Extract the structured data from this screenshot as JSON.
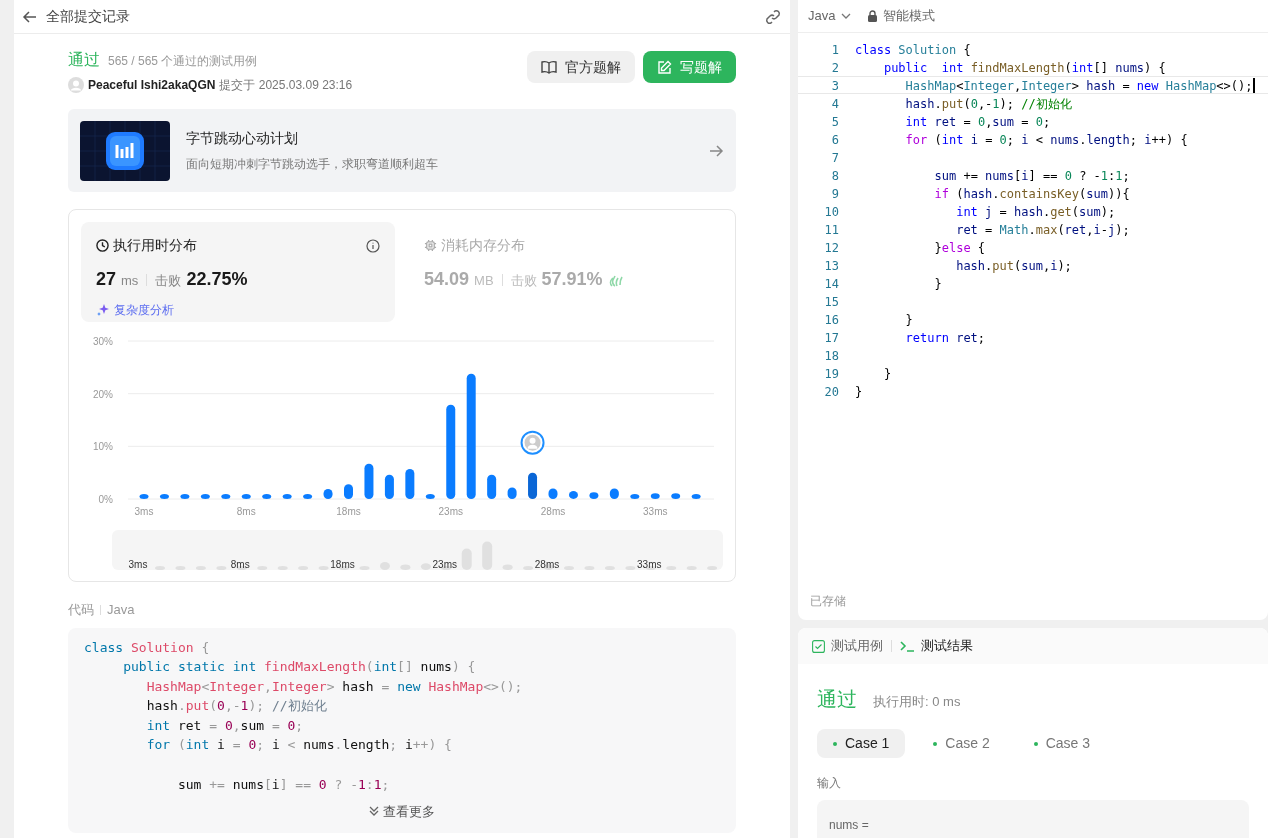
{
  "header": {
    "title": "全部提交记录"
  },
  "submission": {
    "status": "通过",
    "tests": "565 / 565 个通过的测试用例",
    "user": "Peaceful Ishi2akaQGN",
    "submitted": "提交于 2025.03.09 23:16"
  },
  "buttons": [
    {
      "label": "官方题解",
      "kind": "secondary"
    },
    {
      "label": "写题解",
      "kind": "primary"
    }
  ],
  "banner": {
    "kind": "picture",
    "title": "字节跳动心动计划",
    "subtitle": "面向短期冲刺字节跳动选手，求职弯道顺利超车"
  },
  "stats_tabs": [
    {
      "kind": "time",
      "title": "执行用时分布",
      "value": "27",
      "unit": "ms",
      "beats_label": "击败",
      "beats": "22.75%",
      "link": "复杂度分析",
      "selected": true
    },
    {
      "kind": "memory",
      "title": "消耗内存分布",
      "value": "54.09",
      "unit": "MB",
      "beats_label": "击败",
      "beats": "57.91%",
      "selected": false
    }
  ],
  "chart_data": {
    "type": "bar",
    "categories": [
      "3ms",
      null,
      null,
      null,
      null,
      "8ms",
      null,
      null,
      null,
      null,
      "18ms",
      null,
      null,
      null,
      null,
      "23ms",
      null,
      null,
      null,
      null,
      "28ms",
      null,
      null,
      null,
      null,
      "33ms",
      null,
      null
    ],
    "values": [
      0.9,
      0.9,
      0.9,
      0.9,
      0.9,
      0.9,
      0.9,
      0.9,
      0.9,
      1.9,
      2.8,
      6.7,
      4.6,
      5.7,
      0.9,
      17.9,
      23.8,
      4.6,
      2.2,
      5.0,
      2.0,
      1.5,
      1.3,
      2.0,
      0.9,
      1.1,
      1.1,
      0.9
    ],
    "ylim": [
      0,
      30
    ],
    "yticks": [
      {
        "value": 0,
        "label": "0%"
      },
      {
        "value": 10,
        "label": "10%"
      },
      {
        "value": 20,
        "label": "20%"
      },
      {
        "value": 30,
        "label": "30%"
      }
    ]
  },
  "navigator": {
    "labels": [
      "3ms",
      "8ms",
      "18ms",
      "23ms",
      "28ms",
      "33ms"
    ]
  },
  "code_section": {
    "label": "代码",
    "language": "Java",
    "more": "查看更多",
    "lines": [
      {
        "kind": "code",
        "text": "class Solution {"
      },
      {
        "kind": "code",
        "text": "     public static int findMaxLength(int[] nums) {"
      },
      {
        "kind": "code",
        "text": "        HashMap<Integer,Integer> hash = new HashMap<>();"
      },
      {
        "kind": "code",
        "text": "        hash.put(0,-1); //初始化"
      },
      {
        "kind": "code",
        "text": "        int ret = 0,sum = 0;"
      },
      {
        "kind": "code",
        "text": "        for (int i = 0; i < nums.length; i++) {"
      },
      {
        "kind": "blank"
      },
      {
        "kind": "code",
        "text": "            sum += nums[i] == 0 ? -1:1;"
      }
    ]
  },
  "editor": {
    "language": "Java",
    "mode": "智能模式",
    "saved": "已存储",
    "lines": [
      {
        "number": "1",
        "current": false,
        "text": "class Solution {"
      },
      {
        "number": "2",
        "current": false,
        "text": "    public  int findMaxLength(int[] nums) {"
      },
      {
        "number": "3",
        "current": true,
        "text": "       HashMap<Integer,Integer> hash = new HashMap<>();"
      },
      {
        "number": "4",
        "current": false,
        "text": "       hash.put(0,-1); //初始化"
      },
      {
        "number": "5",
        "current": false,
        "text": "       int ret = 0,sum = 0;"
      },
      {
        "number": "6",
        "current": false,
        "text": "       for (int i = 0; i < nums.length; i++) {"
      },
      {
        "number": "7",
        "current": false
      },
      {
        "number": "8",
        "current": false,
        "text": "           sum += nums[i] == 0 ? -1:1;"
      },
      {
        "number": "9",
        "current": false,
        "text": "           if (hash.containsKey(sum)){"
      },
      {
        "number": "10",
        "current": false,
        "text": "              int j = hash.get(sum);"
      },
      {
        "number": "11",
        "current": false,
        "text": "              ret = Math.max(ret,i-j);"
      },
      {
        "number": "12",
        "current": false,
        "text": "           }else {"
      },
      {
        "number": "13",
        "current": false,
        "text": "              hash.put(sum,i);"
      },
      {
        "number": "14",
        "current": false,
        "text": "           }"
      },
      {
        "number": "15",
        "current": false
      },
      {
        "number": "16",
        "current": false,
        "text": "       }"
      },
      {
        "number": "17",
        "current": false,
        "text": "       return ret;"
      },
      {
        "number": "18",
        "current": false
      },
      {
        "number": "19",
        "current": false,
        "text": "    }"
      },
      {
        "number": "20",
        "current": false,
        "text": "}"
      }
    ]
  },
  "test_tabs": [
    {
      "label": "测试用例",
      "kind": "cases",
      "selected": false
    },
    {
      "label": "测试结果",
      "kind": "result",
      "selected": true
    }
  ],
  "result": {
    "status": "通过",
    "runtime": "执行用时: 0 ms"
  },
  "cases": [
    {
      "label": "Case 1",
      "selected": true
    },
    {
      "label": "Case 2",
      "selected": false
    },
    {
      "label": "Case 3",
      "selected": false
    }
  ],
  "input": {
    "label": "输入",
    "name": "nums ="
  }
}
